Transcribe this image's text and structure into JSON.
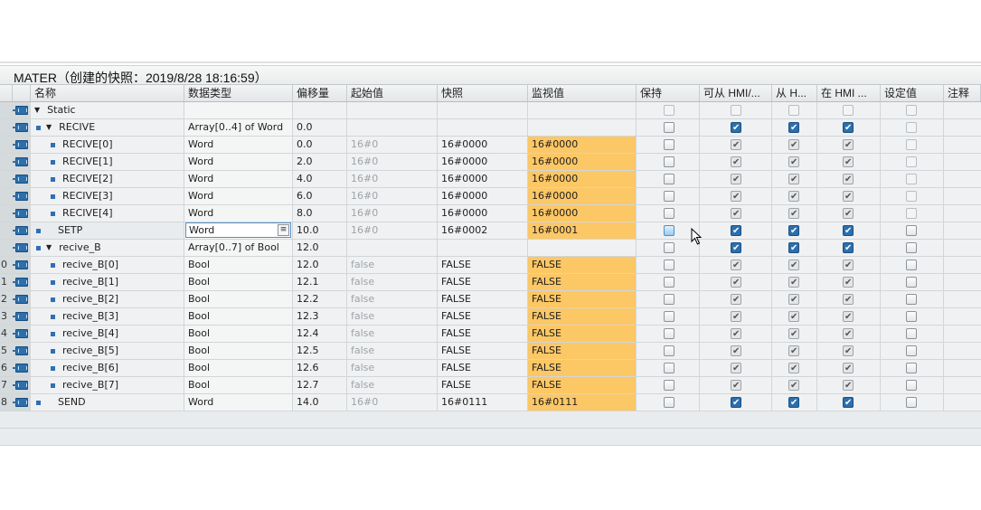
{
  "title": "MATER（创建的快照：2019/8/28 18:16:59）",
  "headers": {
    "name": "名称",
    "datatype": "数据类型",
    "offset": "偏移量",
    "start": "起始值",
    "snapshot": "快照",
    "monitor": "监视值",
    "retain": "保持",
    "hmi_access": "可从 HMI/...",
    "hmi_write": "从 H...",
    "hmi_visible": "在 HMI ...",
    "setpoint": "设定值",
    "comment": "注释"
  },
  "rows": [
    {
      "num": "",
      "name": "Static",
      "type": "",
      "offset": "",
      "start": "",
      "snapshot": "",
      "monitor": "",
      "cb": [
        "off",
        "off",
        "off",
        "off",
        "off"
      ]
    },
    {
      "num": "",
      "name": "RECIVE",
      "type": "Array[0..4] of Word",
      "offset": "0.0",
      "start": "",
      "snapshot": "",
      "monitor": "",
      "cb": [
        "std",
        "chk",
        "chk",
        "chk",
        "off"
      ]
    },
    {
      "num": "",
      "name": "RECIVE[0]",
      "type": "Word",
      "offset": "0.0",
      "start": "16#0",
      "snapshot": "16#0000",
      "monitor": "16#0000",
      "cb": [
        "std",
        "grey",
        "grey",
        "grey",
        "off"
      ]
    },
    {
      "num": "",
      "name": "RECIVE[1]",
      "type": "Word",
      "offset": "2.0",
      "start": "16#0",
      "snapshot": "16#0000",
      "monitor": "16#0000",
      "cb": [
        "std",
        "grey",
        "grey",
        "grey",
        "off"
      ]
    },
    {
      "num": "",
      "name": "RECIVE[2]",
      "type": "Word",
      "offset": "4.0",
      "start": "16#0",
      "snapshot": "16#0000",
      "monitor": "16#0000",
      "cb": [
        "std",
        "grey",
        "grey",
        "grey",
        "off"
      ]
    },
    {
      "num": "",
      "name": "RECIVE[3]",
      "type": "Word",
      "offset": "6.0",
      "start": "16#0",
      "snapshot": "16#0000",
      "monitor": "16#0000",
      "cb": [
        "std",
        "grey",
        "grey",
        "grey",
        "off"
      ]
    },
    {
      "num": "",
      "name": "RECIVE[4]",
      "type": "Word",
      "offset": "8.0",
      "start": "16#0",
      "snapshot": "16#0000",
      "monitor": "16#0000",
      "cb": [
        "std",
        "grey",
        "grey",
        "grey",
        "off"
      ]
    },
    {
      "num": "",
      "name": "SETP",
      "type": "Word",
      "offset": "10.0",
      "start": "16#0",
      "snapshot": "16#0002",
      "monitor": "16#0001",
      "cb": [
        "hl",
        "chk",
        "chk",
        "chk",
        "std"
      ]
    },
    {
      "num": "",
      "name": "recive_B",
      "type": "Array[0..7] of Bool",
      "offset": "12.0",
      "start": "",
      "snapshot": "",
      "monitor": "",
      "cb": [
        "std",
        "chk",
        "chk",
        "chk",
        "std"
      ]
    },
    {
      "num": "0",
      "name": "recive_B[0]",
      "type": "Bool",
      "offset": "12.0",
      "start": "false",
      "snapshot": "FALSE",
      "monitor": "FALSE",
      "cb": [
        "std",
        "grey",
        "grey",
        "grey",
        "std"
      ]
    },
    {
      "num": "1",
      "name": "recive_B[1]",
      "type": "Bool",
      "offset": "12.1",
      "start": "false",
      "snapshot": "FALSE",
      "monitor": "FALSE",
      "cb": [
        "std",
        "grey",
        "grey",
        "grey",
        "std"
      ]
    },
    {
      "num": "2",
      "name": "recive_B[2]",
      "type": "Bool",
      "offset": "12.2",
      "start": "false",
      "snapshot": "FALSE",
      "monitor": "FALSE",
      "cb": [
        "std",
        "grey",
        "grey",
        "grey",
        "std"
      ]
    },
    {
      "num": "3",
      "name": "recive_B[3]",
      "type": "Bool",
      "offset": "12.3",
      "start": "false",
      "snapshot": "FALSE",
      "monitor": "FALSE",
      "cb": [
        "std",
        "grey",
        "grey",
        "grey",
        "std"
      ]
    },
    {
      "num": "4",
      "name": "recive_B[4]",
      "type": "Bool",
      "offset": "12.4",
      "start": "false",
      "snapshot": "FALSE",
      "monitor": "FALSE",
      "cb": [
        "std",
        "grey",
        "grey",
        "grey",
        "std"
      ]
    },
    {
      "num": "5",
      "name": "recive_B[5]",
      "type": "Bool",
      "offset": "12.5",
      "start": "false",
      "snapshot": "FALSE",
      "monitor": "FALSE",
      "cb": [
        "std",
        "grey",
        "grey",
        "grey",
        "std"
      ]
    },
    {
      "num": "6",
      "name": "recive_B[6]",
      "type": "Bool",
      "offset": "12.6",
      "start": "false",
      "snapshot": "FALSE",
      "monitor": "FALSE",
      "cb": [
        "std",
        "grey",
        "grey",
        "grey",
        "std"
      ]
    },
    {
      "num": "7",
      "name": "recive_B[7]",
      "type": "Bool",
      "offset": "12.7",
      "start": "false",
      "snapshot": "FALSE",
      "monitor": "FALSE",
      "cb": [
        "std",
        "grey",
        "grey",
        "grey",
        "std"
      ]
    },
    {
      "num": "8",
      "name": "SEND",
      "type": "Word",
      "offset": "14.0",
      "start": "16#0",
      "snapshot": "16#0111",
      "monitor": "16#0111",
      "cb": [
        "std",
        "chk",
        "chk",
        "chk",
        "std"
      ]
    }
  ],
  "colors": {
    "monitor_highlight": "#fcc765",
    "checkbox_checked": "#2c6fad"
  },
  "icons": {
    "row_icon": "db-tag-icon",
    "expand": "triangle-down-icon",
    "edit": "list-button-icon",
    "pointer": "mouse-cursor-icon"
  }
}
